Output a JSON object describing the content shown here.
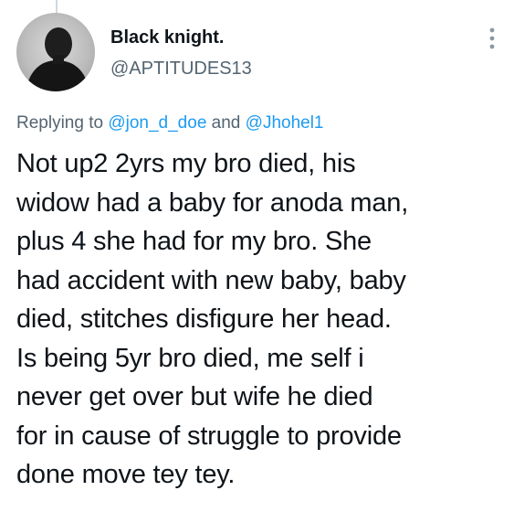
{
  "tweet": {
    "author": {
      "display_name": "Black knight.",
      "handle": "@APTITUDES13",
      "avatar_icon": "user-avatar-dark-silhouette"
    },
    "reply": {
      "prefix": "Replying to",
      "mention_1": "@jon_d_doe",
      "connector": "and",
      "mention_2": "@Jhohel1"
    },
    "text_lines": [
      "Not up2 2yrs my bro died, his",
      "widow had a baby for anoda man,",
      "plus 4 she had for my bro. She",
      "had accident with new baby, baby",
      "died, stitches disfigure her head.",
      "Is being 5yr bro died, me self i",
      "never get over but wife he died",
      "for in cause of struggle to provide",
      "done move tey tey."
    ],
    "more_icon": "vertical-ellipsis-icon"
  },
  "colors": {
    "text": "#0f1419",
    "secondary": "#536471",
    "link": "#1d9bf0",
    "thread_line": "#cfd9de"
  }
}
